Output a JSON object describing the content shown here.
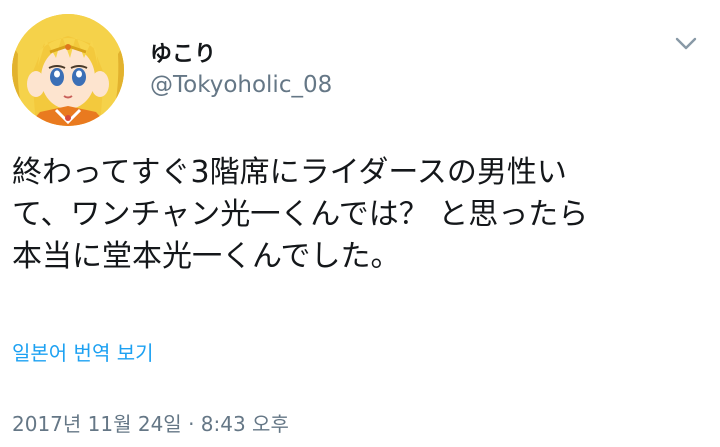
{
  "tweet": {
    "author": {
      "display_name": "ゆこり",
      "handle": "@Tokyoholic_08"
    },
    "text_lines": [
      "終わってすぐ3階席にライダースの男性い",
      "て、ワンチャン光一くんでは？ と思ったら",
      "本当に堂本光一くんでした。"
    ],
    "translate_label": "일본어 번역 보기",
    "timestamp": "2017년 11월 24일 · 8:43 오후"
  },
  "icons": {
    "menu": "chevron-down-icon",
    "avatar": "anime-character-avatar"
  },
  "colors": {
    "text": "#14171a",
    "secondary": "#657786",
    "link": "#1da1f2"
  }
}
